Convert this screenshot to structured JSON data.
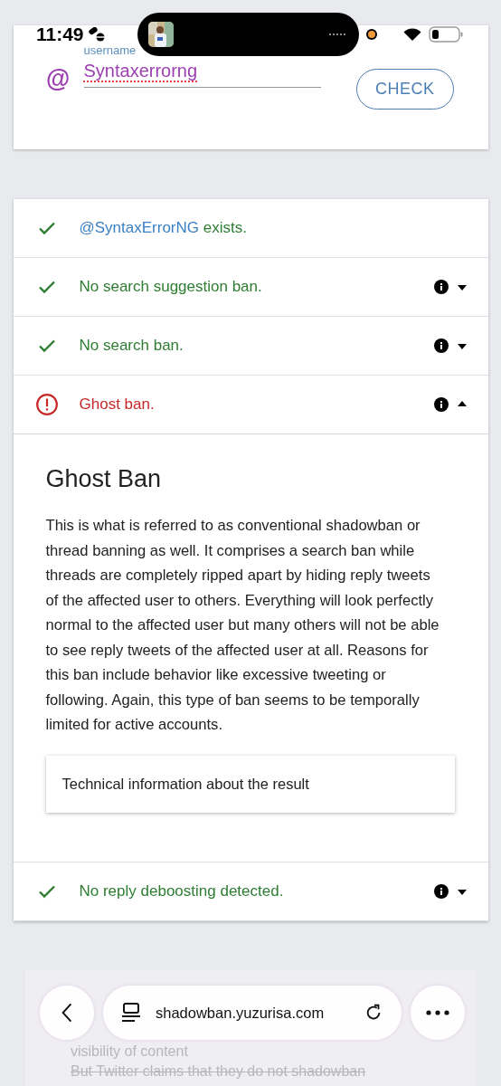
{
  "status_bar": {
    "time": "11:49"
  },
  "lookup": {
    "label": "username",
    "prefix": "@",
    "value": "Syntaxerrorng",
    "button": "CHECK"
  },
  "results": [
    {
      "kind": "ok",
      "handle": "@SyntaxErrorNG",
      "text": " exists.",
      "has_info": false
    },
    {
      "kind": "ok",
      "text": "No search suggestion ban.",
      "has_info": true,
      "expanded": false
    },
    {
      "kind": "ok",
      "text": "No search ban.",
      "has_info": true,
      "expanded": false
    },
    {
      "kind": "error",
      "text": "Ghost ban.",
      "has_info": true,
      "expanded": true,
      "detail": {
        "title": "Ghost Ban",
        "body": "This is what is referred to as conventional shadowban or thread banning as well. It comprises a search ban while threads are completely ripped apart by hiding reply tweets of the affected user to others. Everything will look perfectly normal to the affected user but many others will not be able to see reply tweets of the affected user at all. Reasons for this ban include behavior like excessive tweeting or following. Again, this type of ban seems to be temporally limited for active accounts.",
        "technical": "Technical information about the result"
      }
    },
    {
      "kind": "ok",
      "text": "No reply deboosting detected.",
      "has_info": true,
      "expanded": false
    }
  ],
  "faded_card": {
    "lines": [
      "visibility of content",
      "But Twitter claims that they do not shadowban"
    ]
  },
  "browser_bar": {
    "url": "shadowban.yuzurisa.com"
  }
}
